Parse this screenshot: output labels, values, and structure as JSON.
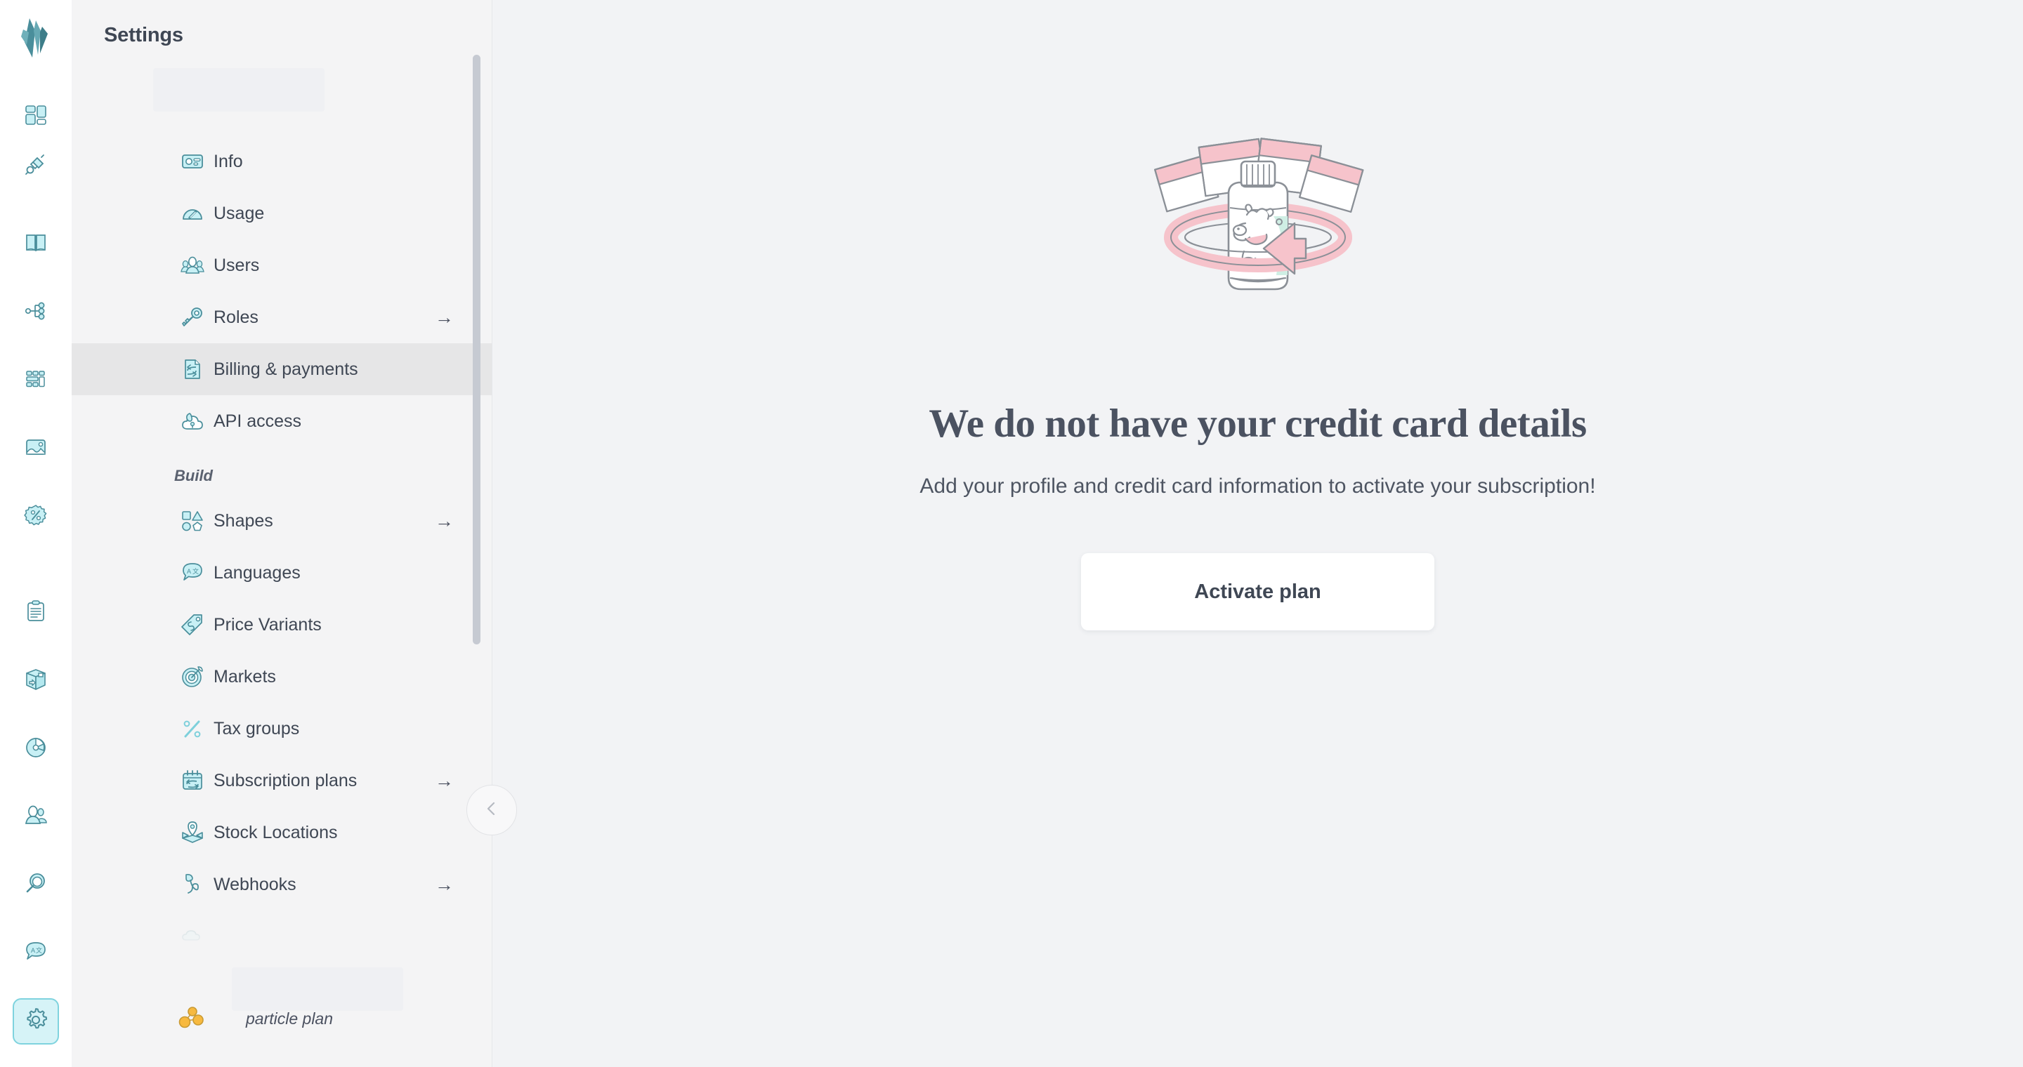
{
  "brand": {
    "logo_name": "crystallize-logo",
    "accent": "#4a8e9b",
    "icon_fill": "#c8f0f5",
    "icon_stroke": "#4a8e9b"
  },
  "rail": {
    "items": [
      {
        "name": "dashboard-icon",
        "label": "Dashboard",
        "active": false
      },
      {
        "name": "plug-icon",
        "label": "Integrations",
        "active": false
      },
      {
        "name": "catalogue-book-icon",
        "label": "Catalogue",
        "active": false
      },
      {
        "name": "topics-tree-icon",
        "label": "Topics",
        "active": false
      },
      {
        "name": "components-grid-icon",
        "label": "Components",
        "active": false
      },
      {
        "name": "media-image-icon",
        "label": "Media",
        "active": false
      },
      {
        "name": "discounts-percent-icon",
        "label": "Discounts",
        "active": false
      },
      {
        "name": "orders-clipboard-icon",
        "label": "Orders",
        "active": false
      },
      {
        "name": "shipments-box-icon",
        "label": "Shipments",
        "active": false
      },
      {
        "name": "analytics-pie-icon",
        "label": "Analytics",
        "active": false
      },
      {
        "name": "customers-icon",
        "label": "Customers",
        "active": false
      },
      {
        "name": "search-icon",
        "label": "Search",
        "active": false
      },
      {
        "name": "translation-icon",
        "label": "Translations",
        "active": false
      },
      {
        "name": "gear-icon",
        "label": "Settings",
        "active": true
      }
    ]
  },
  "panel": {
    "title": "Settings",
    "menu": [
      {
        "label": "Info",
        "icon": "info-card-icon",
        "arrow": false,
        "selected": false
      },
      {
        "label": "Usage",
        "icon": "usage-gauge-icon",
        "arrow": false,
        "selected": false
      },
      {
        "label": "Users",
        "icon": "users-icon",
        "arrow": false,
        "selected": false
      },
      {
        "label": "Roles",
        "icon": "roles-key-icon",
        "arrow": true,
        "selected": false
      },
      {
        "label": "Billing & payments",
        "icon": "billing-document-icon",
        "arrow": false,
        "selected": true
      },
      {
        "label": "API access",
        "icon": "api-cloud-icon",
        "arrow": false,
        "selected": false
      }
    ],
    "section_build_label": "Build",
    "build_menu": [
      {
        "label": "Shapes",
        "icon": "shapes-icon",
        "arrow": true,
        "selected": false
      },
      {
        "label": "Languages",
        "icon": "languages-icon",
        "arrow": false,
        "selected": false
      },
      {
        "label": "Price Variants",
        "icon": "price-tag-icon",
        "arrow": false,
        "selected": false
      },
      {
        "label": "Markets",
        "icon": "markets-target-icon",
        "arrow": false,
        "selected": false
      },
      {
        "label": "Tax groups",
        "icon": "tax-percent-icon",
        "arrow": false,
        "selected": false
      },
      {
        "label": "Subscription plans",
        "icon": "subscription-calendar-icon",
        "arrow": true,
        "selected": false
      },
      {
        "label": "Stock Locations",
        "icon": "stock-location-icon",
        "arrow": false,
        "selected": false
      },
      {
        "label": "Webhooks",
        "icon": "webhooks-hook-icon",
        "arrow": true,
        "selected": false
      }
    ],
    "plan": {
      "label": "particle plan",
      "icon": "particle-molecule-icon",
      "color": "#f5b43f"
    },
    "collapse_icon": "chevron-left-icon"
  },
  "main": {
    "illustration_name": "medicine-bottle-illustration",
    "headline": "We do not have your credit card details",
    "subline": "Add your profile and credit card information to activate your subscription!",
    "activate_label": "Activate plan"
  },
  "colors": {
    "panel_bg": "#f4f4f5",
    "main_bg": "#f2f3f5",
    "selected_row": "#e6e6e7",
    "text": "#3f4754",
    "illus_pink": "#f6c3cb",
    "illus_mint": "#cfeee4",
    "illus_gray": "#8b9097"
  }
}
